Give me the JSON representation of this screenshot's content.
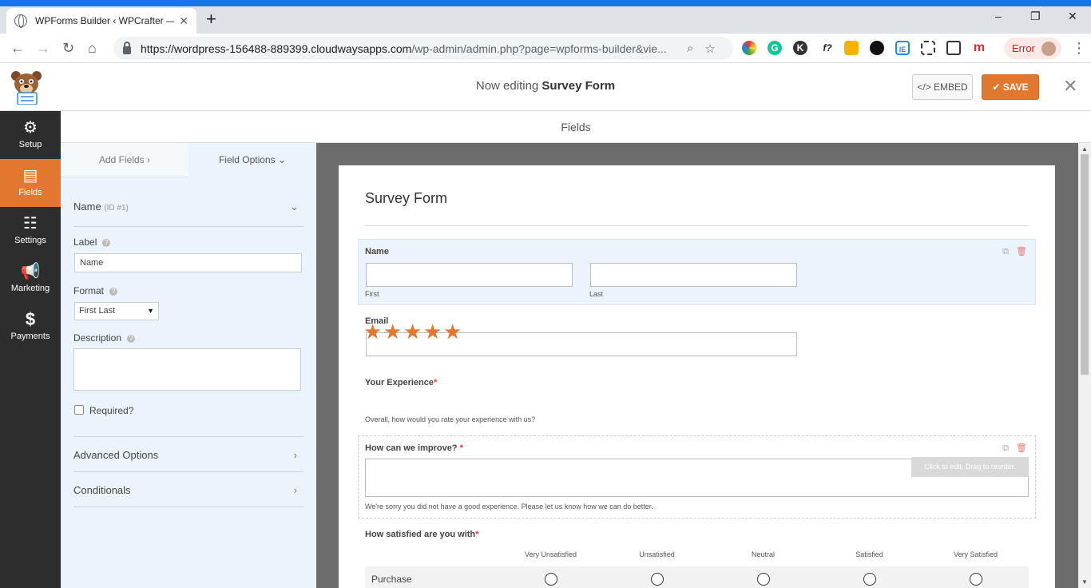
{
  "browser": {
    "tab_title": "WPForms Builder ‹ WPCrafter —",
    "tab_close": "✕",
    "new_tab": "+",
    "url_host": "https://wordpress-156488-889399.cloudwaysapps.com",
    "url_path": "/wp-admin/admin.php?page=wpforms-builder&vie...",
    "error_label": "Error",
    "win_min": "–",
    "win_restore": "❐",
    "win_close": "✕",
    "back": "←",
    "forward": "→",
    "reload": "↻",
    "home": "⌂",
    "kebab": "⋮",
    "ext_f": "f?"
  },
  "header": {
    "editing_prefix": "Now editing ",
    "form_name": "Survey Form",
    "embed_label": "</> EMBED",
    "save_label": "✔ SAVE",
    "close": "✕"
  },
  "sidebar": {
    "items": [
      {
        "label": "Setup",
        "icon": "gear-icon",
        "glyph": "⚙"
      },
      {
        "label": "Fields",
        "icon": "list-icon",
        "glyph": "▤"
      },
      {
        "label": "Settings",
        "icon": "sliders-icon",
        "glyph": "☷"
      },
      {
        "label": "Marketing",
        "icon": "megaphone-icon",
        "glyph": "📢"
      },
      {
        "label": "Payments",
        "icon": "dollar-icon",
        "glyph": "$"
      }
    ]
  },
  "fields_bar": {
    "title": "Fields"
  },
  "panel": {
    "tab_add": "Add Fields ›",
    "tab_options": "Field Options ⌄",
    "field_name": "Name",
    "field_id": "(ID #1)",
    "label_label": "Label",
    "label_value": "Name",
    "format_label": "Format",
    "format_value": "First Last",
    "description_label": "Description",
    "required_label": "Required",
    "advanced_label": "Advanced Options",
    "conditionals_label": "Conditionals",
    "help": "?",
    "chev_down": "⌄",
    "chev_right": "›"
  },
  "form": {
    "title": "Survey Form",
    "name_label": "Name",
    "first_sub": "First",
    "last_sub": "Last",
    "email_label": "Email",
    "experience_label": "Your Experience",
    "experience_desc": "Overall, how would you rate your experience with us?",
    "improve_label": "How can we improve?",
    "improve_desc": "We're sorry you did not have a good experience. Please let us know how we can do better.",
    "tooltip": "Click to edit. Drag to reorder.",
    "satisfied_label": "How satisfied are you with",
    "required_mark": "*",
    "star": "★",
    "likert_columns": [
      "Very Unsatisfied",
      "Unsatisfied",
      "Neutral",
      "Satisfied",
      "Very Satisfied"
    ],
    "likert_row": "Purchase"
  },
  "colors": {
    "accent": "#e27730",
    "sidebar_bg": "#2d2d2d",
    "panel_bg": "#ebf3fc",
    "browser_blue": "#1a73e8"
  }
}
